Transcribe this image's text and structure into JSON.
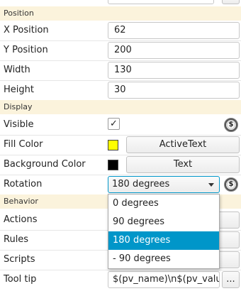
{
  "sections": {
    "position": "Position",
    "display": "Display",
    "behavior": "Behavior"
  },
  "position": {
    "x_label": "X Position",
    "x_value": "62",
    "y_label": "Y Position",
    "y_value": "200",
    "width_label": "Width",
    "width_value": "130",
    "height_label": "Height",
    "height_value": "30"
  },
  "display": {
    "visible_label": "Visible",
    "visible_checked": "✓",
    "fill_color_label": "Fill Color",
    "fill_color_swatch": "#ffff00",
    "fill_color_button": "ActiveText",
    "bg_color_label": "Background Color",
    "bg_color_swatch": "#000000",
    "bg_color_button": "Text",
    "rotation_label": "Rotation",
    "rotation_value": "180 degrees"
  },
  "behavior": {
    "actions_label": "Actions",
    "rules_label": "Rules",
    "scripts_label": "Scripts",
    "tooltip_label": "Tool tip",
    "tooltip_value": "$(pv_name)\\n$(pv_valu",
    "ellipsis": "..."
  },
  "rotation_options": [
    "0 degrees",
    "90 degrees",
    "180 degrees",
    "- 90 degrees"
  ],
  "rotation_selected_index": 2,
  "rule_icon_glyph": "$"
}
